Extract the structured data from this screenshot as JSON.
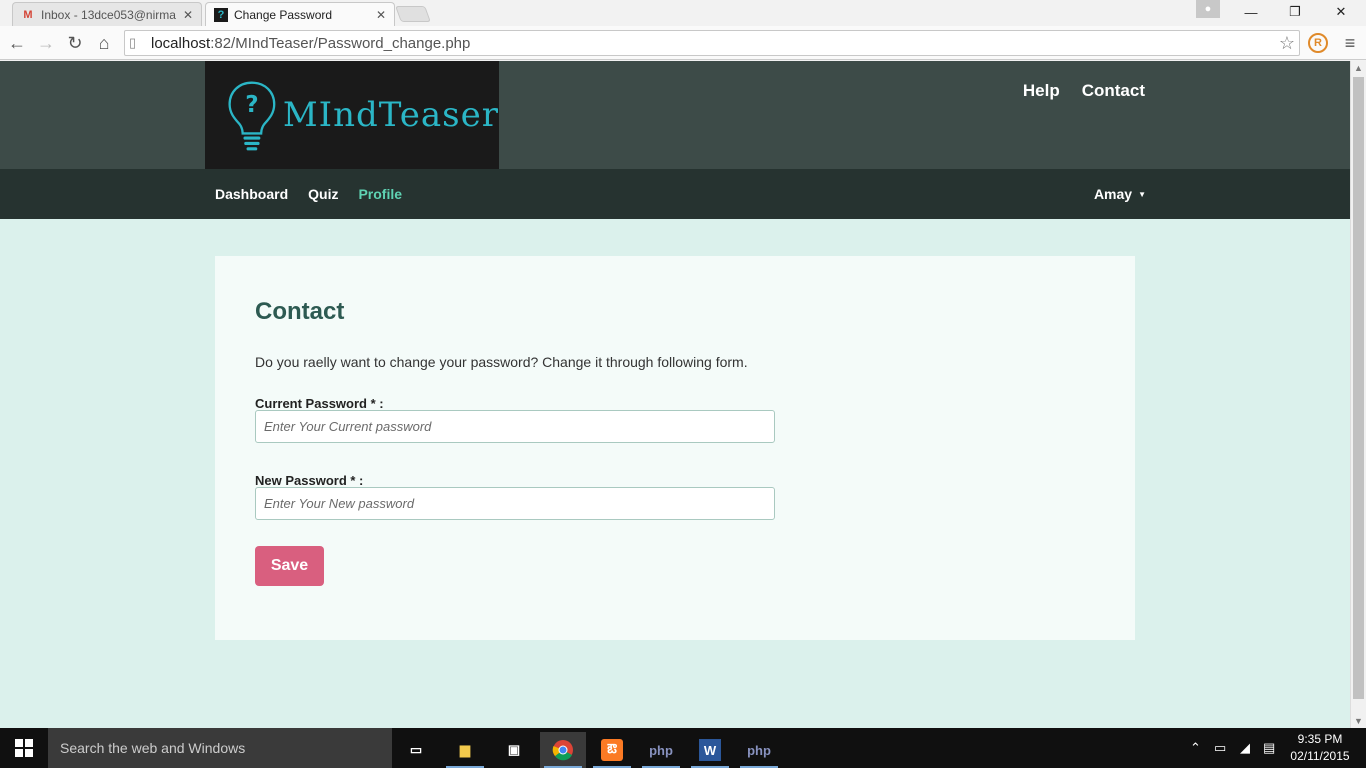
{
  "browser": {
    "tabs": [
      {
        "title": "Inbox - 13dce053@nirma",
        "active": false,
        "icon": "gmail-icon"
      },
      {
        "title": "Change Password",
        "active": true,
        "icon": "site-favicon-icon"
      }
    ],
    "address": {
      "host": "localhost",
      "rest": ":82/MIndTeaser/Password_change.php"
    }
  },
  "site": {
    "logo_text": "MIndTeaser",
    "top_links": {
      "help": "Help",
      "contact": "Contact"
    },
    "nav": {
      "dashboard": "Dashboard",
      "quiz": "Quiz",
      "profile": "Profile",
      "active": "Profile"
    },
    "user": "Amay"
  },
  "form": {
    "heading": "Contact",
    "intro": "Do you raelly want to change your password? Change it through following form.",
    "current_label": "Current Password * :",
    "current_placeholder": "Enter Your Current password",
    "new_label": "New Password * :",
    "new_placeholder": "Enter Your New password",
    "save_label": "Save"
  },
  "taskbar": {
    "search_placeholder": "Search the web and Windows",
    "time": "9:35 PM",
    "date": "02/11/2015"
  },
  "colors": {
    "header_bg": "#3d4b48",
    "nav_bg": "#263330",
    "page_bg": "#dbf1ec",
    "accent_nav": "#5fd3b3",
    "save_button": "#d95f7f",
    "logo_text": "#2bb6c6"
  }
}
